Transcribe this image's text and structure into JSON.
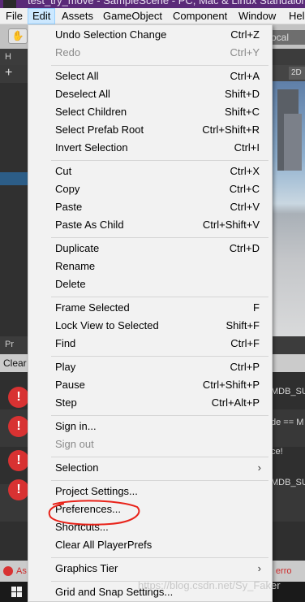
{
  "window": {
    "title": "test_try_move - SampleScene - PC, Mac & Linux Standalone"
  },
  "menubar": {
    "file": "File",
    "edit": "Edit",
    "assets": "Assets",
    "gameobject": "GameObject",
    "component": "Component",
    "window": "Window",
    "help": "Hel"
  },
  "toolbar": {
    "hand": "✋",
    "local": "ocal"
  },
  "hierarchy": {
    "tab": "H",
    "plus": "+"
  },
  "scene": {
    "btn_2d": "2D"
  },
  "console": {
    "tab": "Pr",
    "clear": "Clear",
    "fragments": [
      "MDB_SU",
      "de == M",
      "ce!",
      "MDB_SU"
    ]
  },
  "status": {
    "left": "As",
    "right": "| erro"
  },
  "edit_menu": {
    "items": [
      {
        "label": "Undo Selection Change",
        "shortcut": "Ctrl+Z",
        "enabled": true
      },
      {
        "label": "Redo",
        "shortcut": "Ctrl+Y",
        "enabled": false
      },
      {
        "label": "Select All",
        "shortcut": "Ctrl+A",
        "enabled": true
      },
      {
        "label": "Deselect All",
        "shortcut": "Shift+D",
        "enabled": true
      },
      {
        "label": "Select Children",
        "shortcut": "Shift+C",
        "enabled": true
      },
      {
        "label": "Select Prefab Root",
        "shortcut": "Ctrl+Shift+R",
        "enabled": true
      },
      {
        "label": "Invert Selection",
        "shortcut": "Ctrl+I",
        "enabled": true
      },
      {
        "label": "Cut",
        "shortcut": "Ctrl+X",
        "enabled": true
      },
      {
        "label": "Copy",
        "shortcut": "Ctrl+C",
        "enabled": true
      },
      {
        "label": "Paste",
        "shortcut": "Ctrl+V",
        "enabled": true
      },
      {
        "label": "Paste As Child",
        "shortcut": "Ctrl+Shift+V",
        "enabled": true
      },
      {
        "label": "Duplicate",
        "shortcut": "Ctrl+D",
        "enabled": true
      },
      {
        "label": "Rename",
        "shortcut": "",
        "enabled": true
      },
      {
        "label": "Delete",
        "shortcut": "",
        "enabled": true
      },
      {
        "label": "Frame Selected",
        "shortcut": "F",
        "enabled": true
      },
      {
        "label": "Lock View to Selected",
        "shortcut": "Shift+F",
        "enabled": true
      },
      {
        "label": "Find",
        "shortcut": "Ctrl+F",
        "enabled": true
      },
      {
        "label": "Play",
        "shortcut": "Ctrl+P",
        "enabled": true
      },
      {
        "label": "Pause",
        "shortcut": "Ctrl+Shift+P",
        "enabled": true
      },
      {
        "label": "Step",
        "shortcut": "Ctrl+Alt+P",
        "enabled": true
      },
      {
        "label": "Sign in...",
        "shortcut": "",
        "enabled": true
      },
      {
        "label": "Sign out",
        "shortcut": "",
        "enabled": false
      },
      {
        "label": "Selection",
        "shortcut": "",
        "enabled": true,
        "submenu": true
      },
      {
        "label": "Project Settings...",
        "shortcut": "",
        "enabled": true
      },
      {
        "label": "Preferences...",
        "shortcut": "",
        "enabled": true,
        "highlighted": true
      },
      {
        "label": "Shortcuts...",
        "shortcut": "",
        "enabled": true
      },
      {
        "label": "Clear All PlayerPrefs",
        "shortcut": "",
        "enabled": true
      },
      {
        "label": "Graphics Tier",
        "shortcut": "",
        "enabled": true,
        "submenu": true
      },
      {
        "label": "Grid and Snap Settings...",
        "shortcut": "",
        "enabled": true
      }
    ],
    "submenu_arrow": "›"
  },
  "annotation": {
    "color": "#e8231a",
    "target": "Preferences..."
  },
  "watermark": "https://blog.csdn.net/Sy_Faker",
  "icons": [
    "hand-icon",
    "plus-icon",
    "error-icon",
    "windows-logo-icon",
    "submenu-arrow-icon"
  ]
}
